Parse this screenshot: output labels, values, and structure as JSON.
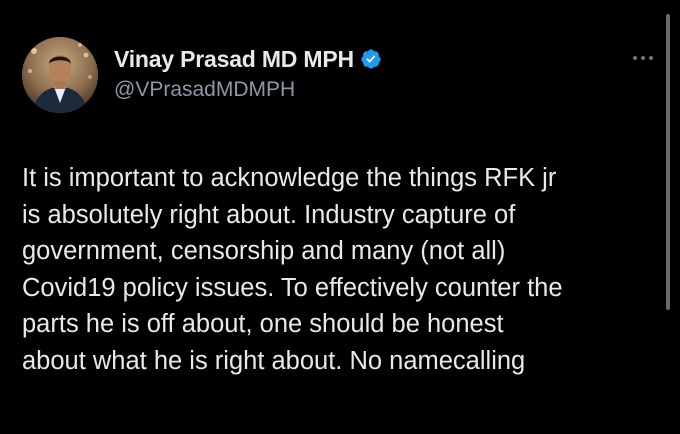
{
  "tweet": {
    "author": {
      "display_name": "Vinay Prasad MD MPH",
      "handle": "@VPrasadMDMPH",
      "verified": true,
      "verified_color": "#1d9bf0",
      "avatar_icon": "profile-photo"
    },
    "more_icon": "ellipsis-icon",
    "text_lines": [
      "It is important to acknowledge the things RFK jr",
      "is absolutely right about.  Industry capture of",
      "government, censorship and many (not all)",
      "Covid19 policy issues. To effectively counter the",
      "parts he is off about, one should be honest",
      "about what he is right about. No namecalling"
    ]
  },
  "colors": {
    "background": "#000000",
    "text_primary": "#e7e9ea",
    "text_secondary": "#8b98a5"
  }
}
